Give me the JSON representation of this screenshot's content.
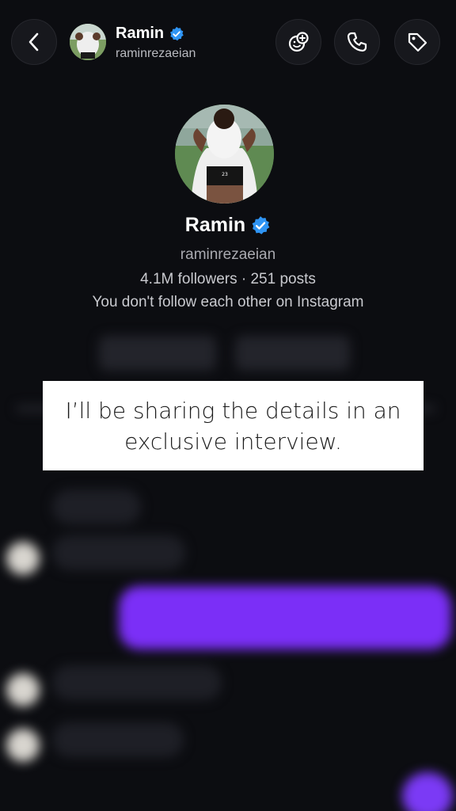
{
  "header": {
    "name": "Ramin",
    "username": "raminrezaeian",
    "icons": {
      "back": "chevron-left-icon",
      "effects": "sticker-add-icon",
      "call": "phone-icon",
      "tag": "tag-icon",
      "verified": "verified-badge-icon"
    }
  },
  "profile": {
    "name": "Ramin",
    "username": "raminrezaeian",
    "stats": "4.1M followers · 251 posts",
    "note": "You don't follow each other on Instagram"
  },
  "caption": {
    "text": "I’ll be sharing the details in an exclusive interview."
  },
  "colors": {
    "background": "#0c0d11",
    "verified": "#2f95f5",
    "outgoing_bubble": "#7b2ff7",
    "incoming_bubble": "#1e1f26"
  }
}
